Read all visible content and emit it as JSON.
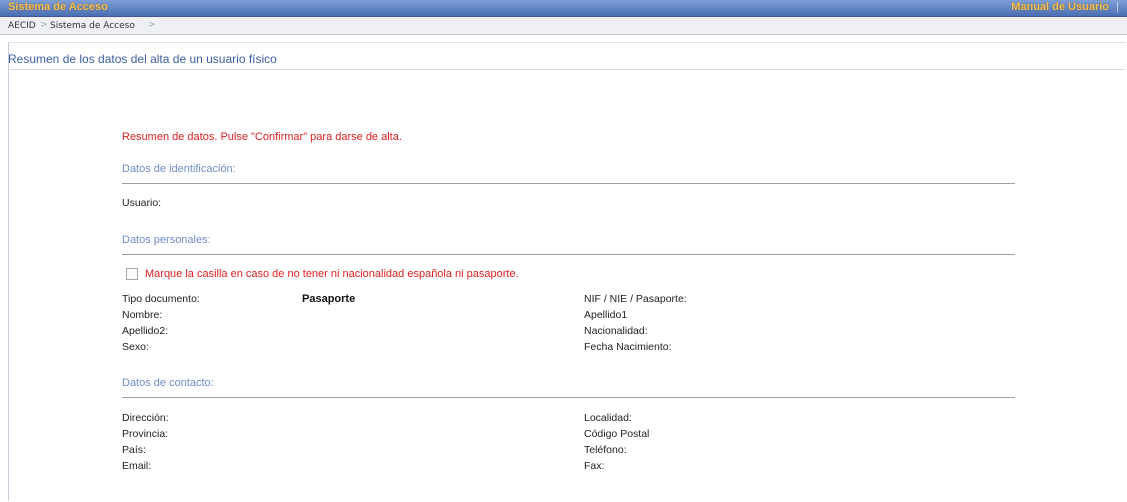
{
  "header": {
    "app_title": "Sistema de Acceso",
    "manual_link": "Manual de Usuario",
    "separator": "|"
  },
  "breadcrumb": {
    "items": [
      "AECID",
      "Sistema de Acceso"
    ],
    "arrow": ">"
  },
  "page": {
    "title": "Resumen de los datos del alta de un usuario físico"
  },
  "notice": "Resumen de datos. Pulse \"Confirmar\" para darse de alta.",
  "identificacion": {
    "title": "Datos de identificación:",
    "usuario_label": "Usuario:"
  },
  "personales": {
    "title": "Datos personales:",
    "checkbox_label": "Marque la casilla en caso de no tener ni nacionalidad española ni pasaporte.",
    "checkbox_checked": false,
    "tipo_documento_label": "Tipo documento:",
    "tipo_documento_value": "Pasaporte",
    "nif_label": "NIF / NIE / Pasaporte:",
    "nombre_label": "Nombre:",
    "apellido1_label": "Apellido1",
    "apellido2_label": "Apellido2:",
    "nacionalidad_label": "Nacionalidad:",
    "sexo_label": "Sexo:",
    "fecha_nacimiento_label": "Fecha Nacimiento:"
  },
  "contacto": {
    "title": "Datos de contacto:",
    "direccion_label": "Dirección:",
    "localidad_label": "Localidad:",
    "provincia_label": "Provincia:",
    "codigo_postal_label": "Código Postal",
    "pais_label": "País:",
    "telefono_label": "Teléfono:",
    "email_label": "Email:",
    "fax_label": "Fax:"
  },
  "colors": {
    "header_gradient_top": "#7f9fd6",
    "header_gradient_bottom": "#4a6eb4",
    "header_text": "#f6c05a",
    "page_title": "#3a5fa8",
    "section_title": "#6d8ec6",
    "notice": "#e02020"
  }
}
